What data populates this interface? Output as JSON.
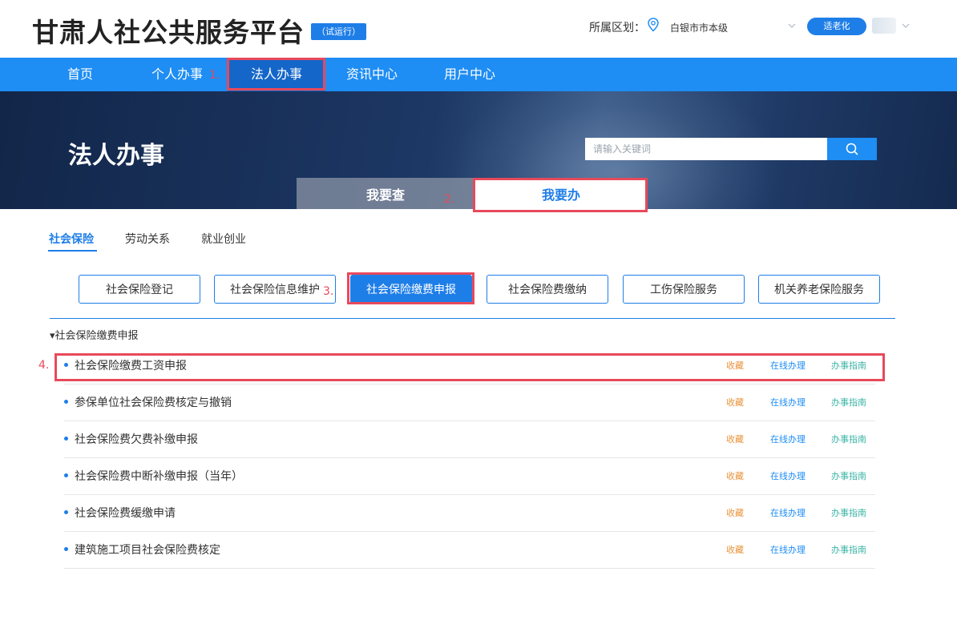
{
  "header": {
    "site_title": "甘肃人社公共服务平台",
    "trial_badge": "（试运行）",
    "region_label": "所属区划：",
    "region_value": "白银市市本级",
    "elder_mode_label": "适老化"
  },
  "nav": {
    "items": [
      {
        "label": "首页"
      },
      {
        "label": "个人办事"
      },
      {
        "label": "法人办事",
        "active": true
      },
      {
        "label": "资讯中心"
      },
      {
        "label": "用户中心"
      }
    ]
  },
  "banner": {
    "title": "法人办事",
    "search_placeholder": "请输入关键词",
    "tabs": [
      {
        "label": "我要查"
      },
      {
        "label": "我要办",
        "active": true
      }
    ]
  },
  "categories": {
    "tabs": [
      {
        "label": "社会保险",
        "active": true
      },
      {
        "label": "劳动关系"
      },
      {
        "label": "就业创业"
      }
    ]
  },
  "services": {
    "buttons": [
      {
        "label": "社会保险登记"
      },
      {
        "label": "社会保险信息维护"
      },
      {
        "label": "社会保险缴费申报",
        "active": true
      },
      {
        "label": "社会保险费缴纳"
      },
      {
        "label": "工伤保险服务"
      },
      {
        "label": "机关养老保险服务"
      }
    ]
  },
  "section": {
    "title": "▾社会保险缴费申报",
    "items": [
      {
        "label": "社会保险缴费工资申报",
        "fav": "收藏",
        "online": "在线办理",
        "guide": "办事指南"
      },
      {
        "label": "参保单位社会保险费核定与撤销",
        "fav": "收藏",
        "online": "在线办理",
        "guide": "办事指南"
      },
      {
        "label": "社会保险费欠费补缴申报",
        "fav": "收藏",
        "online": "在线办理",
        "guide": "办事指南"
      },
      {
        "label": "社会保险费中断补缴申报（当年）",
        "fav": "收藏",
        "online": "在线办理",
        "guide": "办事指南"
      },
      {
        "label": "社会保险费缓缴申请",
        "fav": "收藏",
        "online": "在线办理",
        "guide": "办事指南"
      },
      {
        "label": "建筑施工项目社会保险费核定",
        "fav": "收藏",
        "online": "在线办理",
        "guide": "办事指南"
      }
    ]
  },
  "annotations": {
    "step1": "1.",
    "step2": "2.",
    "step3": "3.",
    "step4": "4."
  },
  "colors": {
    "brand_blue": "#1e8df4",
    "nav_active": "#1566c9",
    "annotation_red": "#e8495b",
    "favorite_orange": "#e8933a",
    "guide_teal": "#3cb4a6"
  },
  "icons": {
    "location": "map-pin-icon",
    "search": "search-icon",
    "dropdown": "chevron-down-icon"
  }
}
